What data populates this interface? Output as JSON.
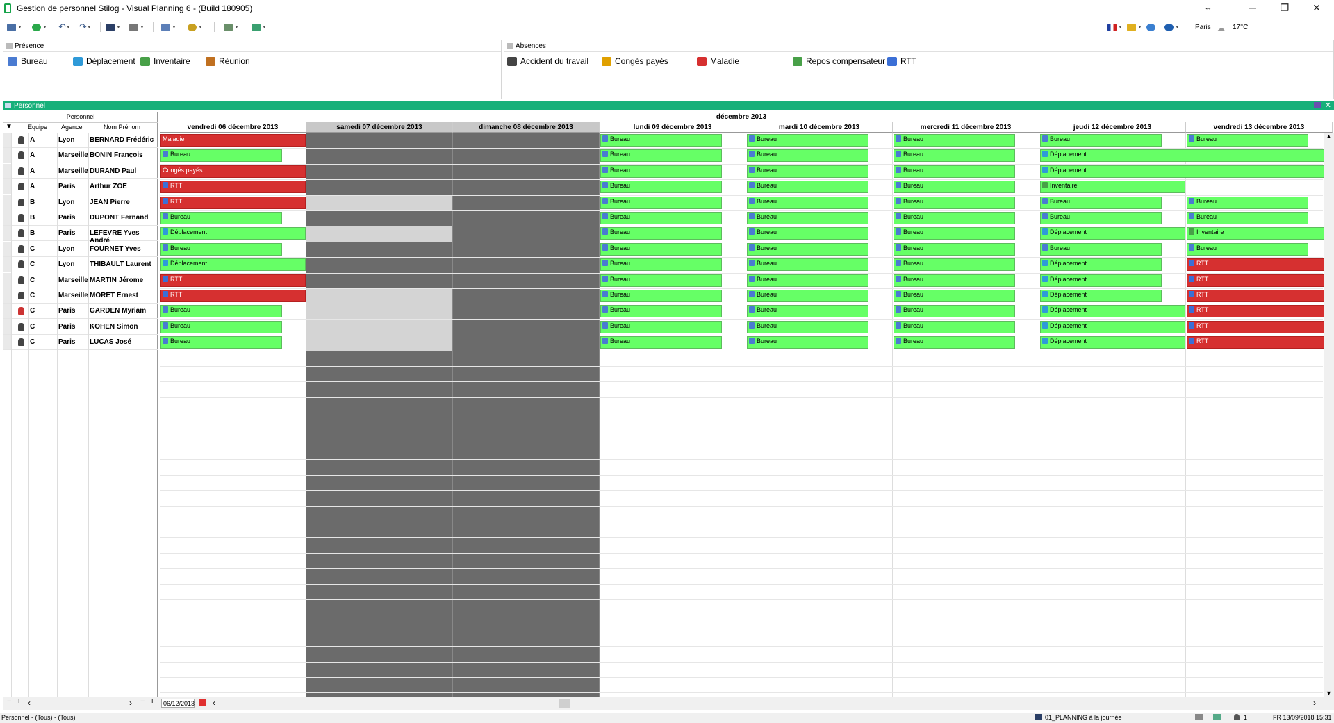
{
  "window": {
    "title": "Gestion de personnel Stilog - Visual Planning 6 - (Build 180905)",
    "minimize": "─",
    "maximize": "❐",
    "close": "✕",
    "restore_arrow": "↔"
  },
  "toolbar": {
    "city": "Paris",
    "temperature": "17°C"
  },
  "presence": {
    "title": "Présence",
    "items": [
      {
        "label": "Bureau",
        "color": "#4a7bd1"
      },
      {
        "label": "Déplacement",
        "color": "#2f9ad8"
      },
      {
        "label": "Inventaire",
        "color": "#48a048"
      },
      {
        "label": "Réunion",
        "color": "#c07020"
      }
    ]
  },
  "absences": {
    "title": "Absences",
    "items": [
      {
        "label": "Accident du travail",
        "color": "#444444"
      },
      {
        "label": "Congés payés",
        "color": "#e0a000"
      },
      {
        "label": "Maladie",
        "color": "#d63030"
      },
      {
        "label": "Repos compensateur",
        "color": "#48a048"
      },
      {
        "label": "RTT",
        "color": "#3b6fd6"
      }
    ]
  },
  "grid": {
    "title": "Personnel",
    "left_header": "Personnel",
    "col_headers": {
      "team": "Equipe",
      "agency": "Agence",
      "name": "Nom Prénom"
    },
    "month": "décembre 2013",
    "days": [
      {
        "label": "vendredi 06 décembre 2013",
        "type": "work"
      },
      {
        "label": "samedi 07 décembre 2013",
        "type": "weekend"
      },
      {
        "label": "dimanche 08 décembre 2013",
        "type": "weekend"
      },
      {
        "label": "lundi 09 décembre 2013",
        "type": "work"
      },
      {
        "label": "mardi 10 décembre 2013",
        "type": "work"
      },
      {
        "label": "mercredi 11 décembre 2013",
        "type": "work"
      },
      {
        "label": "jeudi 12 décembre 2013",
        "type": "work"
      },
      {
        "label": "vendredi 13 décembre 2013",
        "type": "work"
      }
    ],
    "rows": [
      {
        "team": "A",
        "agency": "Lyon",
        "name": "BERNARD Frédéric"
      },
      {
        "team": "A",
        "agency": "Marseille",
        "name": "BONIN François"
      },
      {
        "team": "A",
        "agency": "Marseille",
        "name": "DURAND Paul"
      },
      {
        "team": "A",
        "agency": "Paris",
        "name": "Arthur ZOE"
      },
      {
        "team": "B",
        "agency": "Lyon",
        "name": "JEAN Pierre"
      },
      {
        "team": "B",
        "agency": "Paris",
        "name": "DUPONT Fernand"
      },
      {
        "team": "B",
        "agency": "Paris",
        "name": "LEFEVRE Yves André"
      },
      {
        "team": "C",
        "agency": "Lyon",
        "name": "FOURNET Yves"
      },
      {
        "team": "C",
        "agency": "Lyon",
        "name": "THIBAULT Laurent"
      },
      {
        "team": "C",
        "agency": "Marseille",
        "name": "MARTIN Jérome"
      },
      {
        "team": "C",
        "agency": "Marseille",
        "name": "MORET Ernest"
      },
      {
        "team": "C",
        "agency": "Paris",
        "name": "GARDEN Myriam"
      },
      {
        "team": "C",
        "agency": "Paris",
        "name": "KOHEN Simon"
      },
      {
        "team": "C",
        "agency": "Paris",
        "name": "LUCAS José"
      }
    ],
    "events": [
      {
        "row": 0,
        "day": 0,
        "span": 1,
        "full": true,
        "label": "Maladie",
        "kind": "red"
      },
      {
        "row": 0,
        "day": 3,
        "span": 1,
        "full": false,
        "label": "Bureau",
        "kind": "green"
      },
      {
        "row": 0,
        "day": 4,
        "span": 1,
        "full": false,
        "label": "Bureau",
        "kind": "green"
      },
      {
        "row": 0,
        "day": 5,
        "span": 1,
        "full": false,
        "label": "Bureau",
        "kind": "green"
      },
      {
        "row": 0,
        "day": 6,
        "span": 1,
        "full": false,
        "label": "Bureau",
        "kind": "green"
      },
      {
        "row": 0,
        "day": 7,
        "span": 1,
        "full": false,
        "label": "Bureau",
        "kind": "green"
      },
      {
        "row": 1,
        "day": 0,
        "span": 1,
        "full": false,
        "label": "Bureau",
        "kind": "green"
      },
      {
        "row": 1,
        "day": 3,
        "span": 1,
        "full": false,
        "label": "Bureau",
        "kind": "green"
      },
      {
        "row": 1,
        "day": 4,
        "span": 1,
        "full": false,
        "label": "Bureau",
        "kind": "green"
      },
      {
        "row": 1,
        "day": 5,
        "span": 1,
        "full": false,
        "label": "Bureau",
        "kind": "green"
      },
      {
        "row": 1,
        "day": 6,
        "span": 2,
        "full": true,
        "label": "Déplacement",
        "kind": "green"
      },
      {
        "row": 2,
        "day": 0,
        "span": 1,
        "full": true,
        "label": "Congés payés",
        "kind": "red"
      },
      {
        "row": 2,
        "day": 3,
        "span": 1,
        "full": false,
        "label": "Bureau",
        "kind": "green"
      },
      {
        "row": 2,
        "day": 4,
        "span": 1,
        "full": false,
        "label": "Bureau",
        "kind": "green"
      },
      {
        "row": 2,
        "day": 5,
        "span": 1,
        "full": false,
        "label": "Bureau",
        "kind": "green"
      },
      {
        "row": 2,
        "day": 6,
        "span": 2,
        "full": true,
        "label": "Déplacement",
        "kind": "green"
      },
      {
        "row": 3,
        "day": 0,
        "span": 1,
        "full": true,
        "label": "RTT",
        "kind": "red"
      },
      {
        "row": 3,
        "day": 3,
        "span": 1,
        "full": false,
        "label": "Bureau",
        "kind": "green"
      },
      {
        "row": 3,
        "day": 4,
        "span": 1,
        "full": false,
        "label": "Bureau",
        "kind": "green"
      },
      {
        "row": 3,
        "day": 5,
        "span": 1,
        "full": false,
        "label": "Bureau",
        "kind": "green"
      },
      {
        "row": 3,
        "day": 6,
        "span": 1,
        "full": true,
        "label": "Inventaire",
        "kind": "green"
      },
      {
        "row": 4,
        "day": 0,
        "span": 1,
        "full": true,
        "label": "RTT",
        "kind": "red"
      },
      {
        "row": 4,
        "day": 3,
        "span": 1,
        "full": false,
        "label": "Bureau",
        "kind": "green"
      },
      {
        "row": 4,
        "day": 4,
        "span": 1,
        "full": false,
        "label": "Bureau",
        "kind": "green"
      },
      {
        "row": 4,
        "day": 5,
        "span": 1,
        "full": false,
        "label": "Bureau",
        "kind": "green"
      },
      {
        "row": 4,
        "day": 6,
        "span": 1,
        "full": false,
        "label": "Bureau",
        "kind": "green"
      },
      {
        "row": 4,
        "day": 7,
        "span": 1,
        "full": false,
        "label": "Bureau",
        "kind": "green"
      },
      {
        "row": 5,
        "day": 0,
        "span": 1,
        "full": false,
        "label": "Bureau",
        "kind": "green"
      },
      {
        "row": 5,
        "day": 3,
        "span": 1,
        "full": false,
        "label": "Bureau",
        "kind": "green"
      },
      {
        "row": 5,
        "day": 4,
        "span": 1,
        "full": false,
        "label": "Bureau",
        "kind": "green"
      },
      {
        "row": 5,
        "day": 5,
        "span": 1,
        "full": false,
        "label": "Bureau",
        "kind": "green"
      },
      {
        "row": 5,
        "day": 6,
        "span": 1,
        "full": false,
        "label": "Bureau",
        "kind": "green"
      },
      {
        "row": 5,
        "day": 7,
        "span": 1,
        "full": false,
        "label": "Bureau",
        "kind": "green"
      },
      {
        "row": 6,
        "day": 0,
        "span": 1,
        "full": true,
        "label": "Déplacement",
        "kind": "green"
      },
      {
        "row": 6,
        "day": 3,
        "span": 1,
        "full": false,
        "label": "Bureau",
        "kind": "green"
      },
      {
        "row": 6,
        "day": 4,
        "span": 1,
        "full": false,
        "label": "Bureau",
        "kind": "green"
      },
      {
        "row": 6,
        "day": 5,
        "span": 1,
        "full": false,
        "label": "Bureau",
        "kind": "green"
      },
      {
        "row": 6,
        "day": 6,
        "span": 1,
        "full": true,
        "label": "Déplacement",
        "kind": "green"
      },
      {
        "row": 6,
        "day": 7,
        "span": 1,
        "full": true,
        "label": "Inventaire",
        "kind": "green"
      },
      {
        "row": 7,
        "day": 0,
        "span": 1,
        "full": false,
        "label": "Bureau",
        "kind": "green"
      },
      {
        "row": 7,
        "day": 3,
        "span": 1,
        "full": false,
        "label": "Bureau",
        "kind": "green"
      },
      {
        "row": 7,
        "day": 4,
        "span": 1,
        "full": false,
        "label": "Bureau",
        "kind": "green"
      },
      {
        "row": 7,
        "day": 5,
        "span": 1,
        "full": false,
        "label": "Bureau",
        "kind": "green"
      },
      {
        "row": 7,
        "day": 6,
        "span": 1,
        "full": false,
        "label": "Bureau",
        "kind": "green"
      },
      {
        "row": 7,
        "day": 7,
        "span": 1,
        "full": false,
        "label": "Bureau",
        "kind": "green"
      },
      {
        "row": 8,
        "day": 0,
        "span": 1,
        "full": true,
        "label": "Déplacement",
        "kind": "green"
      },
      {
        "row": 8,
        "day": 3,
        "span": 1,
        "full": false,
        "label": "Bureau",
        "kind": "green"
      },
      {
        "row": 8,
        "day": 4,
        "span": 1,
        "full": false,
        "label": "Bureau",
        "kind": "green"
      },
      {
        "row": 8,
        "day": 5,
        "span": 1,
        "full": false,
        "label": "Bureau",
        "kind": "green"
      },
      {
        "row": 8,
        "day": 6,
        "span": 1,
        "full": false,
        "label": "Déplacement",
        "kind": "green"
      },
      {
        "row": 8,
        "day": 7,
        "span": 1,
        "full": true,
        "label": "RTT",
        "kind": "red"
      },
      {
        "row": 9,
        "day": 0,
        "span": 1,
        "full": true,
        "label": "RTT",
        "kind": "red"
      },
      {
        "row": 9,
        "day": 3,
        "span": 1,
        "full": false,
        "label": "Bureau",
        "kind": "green"
      },
      {
        "row": 9,
        "day": 4,
        "span": 1,
        "full": false,
        "label": "Bureau",
        "kind": "green"
      },
      {
        "row": 9,
        "day": 5,
        "span": 1,
        "full": false,
        "label": "Bureau",
        "kind": "green"
      },
      {
        "row": 9,
        "day": 6,
        "span": 1,
        "full": false,
        "label": "Déplacement",
        "kind": "green"
      },
      {
        "row": 9,
        "day": 7,
        "span": 1,
        "full": true,
        "label": "RTT",
        "kind": "red"
      },
      {
        "row": 10,
        "day": 0,
        "span": 1,
        "full": true,
        "label": "RTT",
        "kind": "red"
      },
      {
        "row": 10,
        "day": 3,
        "span": 1,
        "full": false,
        "label": "Bureau",
        "kind": "green"
      },
      {
        "row": 10,
        "day": 4,
        "span": 1,
        "full": false,
        "label": "Bureau",
        "kind": "green"
      },
      {
        "row": 10,
        "day": 5,
        "span": 1,
        "full": false,
        "label": "Bureau",
        "kind": "green"
      },
      {
        "row": 10,
        "day": 6,
        "span": 1,
        "full": false,
        "label": "Déplacement",
        "kind": "green"
      },
      {
        "row": 10,
        "day": 7,
        "span": 1,
        "full": true,
        "label": "RTT",
        "kind": "red"
      },
      {
        "row": 11,
        "day": 0,
        "span": 1,
        "full": false,
        "label": "Bureau",
        "kind": "green"
      },
      {
        "row": 11,
        "day": 3,
        "span": 1,
        "full": false,
        "label": "Bureau",
        "kind": "green"
      },
      {
        "row": 11,
        "day": 4,
        "span": 1,
        "full": false,
        "label": "Bureau",
        "kind": "green"
      },
      {
        "row": 11,
        "day": 5,
        "span": 1,
        "full": false,
        "label": "Bureau",
        "kind": "green"
      },
      {
        "row": 11,
        "day": 6,
        "span": 1,
        "full": true,
        "label": "Déplacement",
        "kind": "green"
      },
      {
        "row": 11,
        "day": 7,
        "span": 1,
        "full": true,
        "label": "RTT",
        "kind": "red"
      },
      {
        "row": 12,
        "day": 0,
        "span": 1,
        "full": false,
        "label": "Bureau",
        "kind": "green"
      },
      {
        "row": 12,
        "day": 3,
        "span": 1,
        "full": false,
        "label": "Bureau",
        "kind": "green"
      },
      {
        "row": 12,
        "day": 4,
        "span": 1,
        "full": false,
        "label": "Bureau",
        "kind": "green"
      },
      {
        "row": 12,
        "day": 5,
        "span": 1,
        "full": false,
        "label": "Bureau",
        "kind": "green"
      },
      {
        "row": 12,
        "day": 6,
        "span": 1,
        "full": true,
        "label": "Déplacement",
        "kind": "green"
      },
      {
        "row": 12,
        "day": 7,
        "span": 1,
        "full": true,
        "label": "RTT",
        "kind": "red"
      },
      {
        "row": 13,
        "day": 0,
        "span": 1,
        "full": false,
        "label": "Bureau",
        "kind": "green"
      },
      {
        "row": 13,
        "day": 3,
        "span": 1,
        "full": false,
        "label": "Bureau",
        "kind": "green"
      },
      {
        "row": 13,
        "day": 4,
        "span": 1,
        "full": false,
        "label": "Bureau",
        "kind": "green"
      },
      {
        "row": 13,
        "day": 5,
        "span": 1,
        "full": false,
        "label": "Bureau",
        "kind": "green"
      },
      {
        "row": 13,
        "day": 6,
        "span": 1,
        "full": true,
        "label": "Déplacement",
        "kind": "green"
      },
      {
        "row": 13,
        "day": 7,
        "span": 1,
        "full": true,
        "label": "RTT",
        "kind": "red"
      }
    ]
  },
  "footer": {
    "date_value": "06/12/2013"
  },
  "status": {
    "left": "Personnel - (Tous) - (Tous)",
    "view": "01_PLANNING à la journée",
    "count": "1",
    "datetime": "FR 13/09/2018 15:31"
  }
}
